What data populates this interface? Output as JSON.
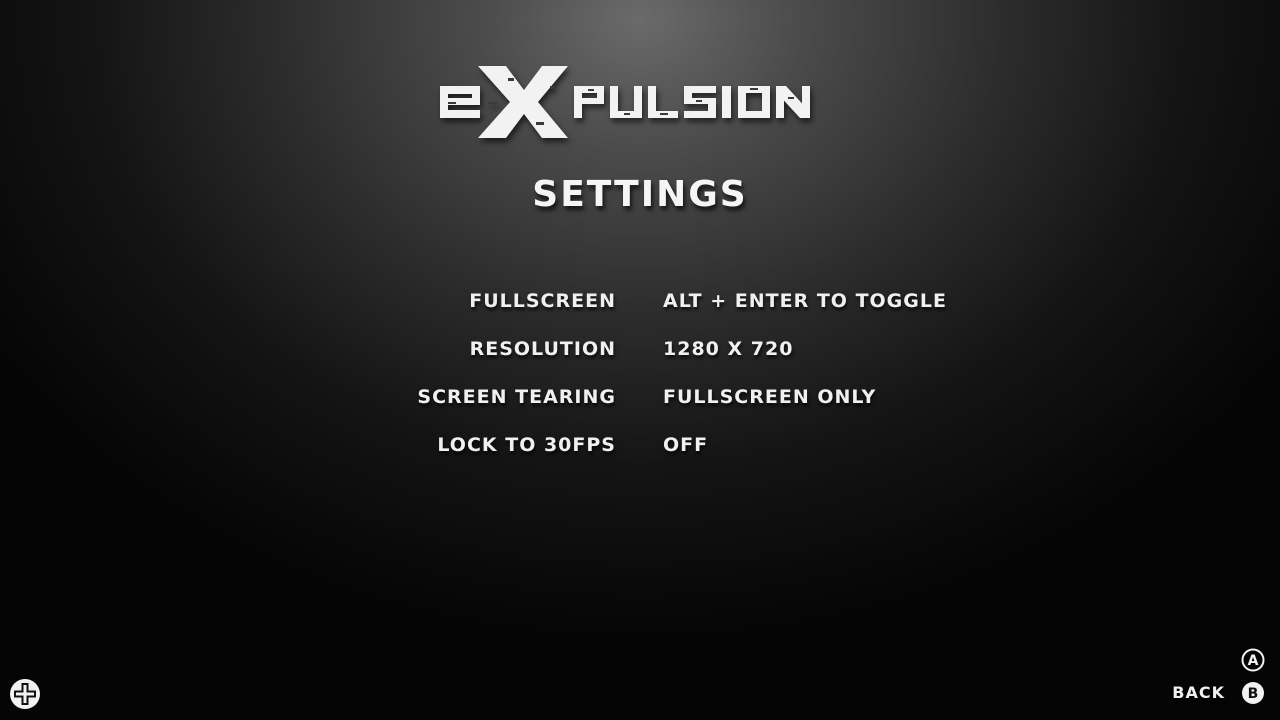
{
  "logo": {
    "text": "eXPULSION"
  },
  "page": {
    "title": "SETTINGS"
  },
  "settings": [
    {
      "label": "FULLSCREEN",
      "value": "ALT + ENTER TO TOGGLE"
    },
    {
      "label": "RESOLUTION",
      "value": "1280 X 720"
    },
    {
      "label": "SCREEN TEARING",
      "value": "FULLSCREEN ONLY"
    },
    {
      "label": "LOCK TO 30FPS",
      "value": "OFF"
    }
  ],
  "controls": {
    "a_button": "A",
    "b_button": "B",
    "back_label": "BACK",
    "dpad_icon": "dpad-icon"
  },
  "colors": {
    "text": "#f0f0f0",
    "background_center": "#6a6a6a",
    "background_edge": "#050505"
  }
}
